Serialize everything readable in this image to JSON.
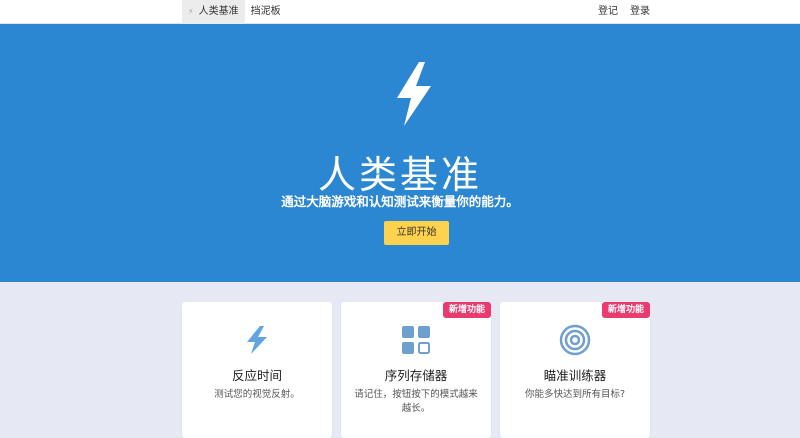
{
  "nav": {
    "home_label": "人类基准",
    "dashboard_label": "挡泥板",
    "signup_label": "登记",
    "login_label": "登录"
  },
  "hero": {
    "title": "人类基准",
    "subtitle": "通过大脑游戏和认知测试来衡量你的能力。",
    "cta_label": "立即开始",
    "bg_color": "#2b87d1",
    "cta_color": "#ffd24d"
  },
  "cards": [
    {
      "title": "反应时间",
      "description": "测试您的视觉反射。",
      "icon": "lightning-bolt-icon",
      "badge": ""
    },
    {
      "title": "序列存储器",
      "description": "请记住，按钮按下的模式越来越长。",
      "icon": "grid-squares-icon",
      "badge": "新增功能"
    },
    {
      "title": "瞄准训练器",
      "description": "你能多快达到所有目标?",
      "icon": "target-icon",
      "badge": "新增功能"
    }
  ],
  "colors": {
    "accent": "#2b87d1",
    "badge": "#ea3b6e",
    "card_icon": "#2b87d1"
  }
}
